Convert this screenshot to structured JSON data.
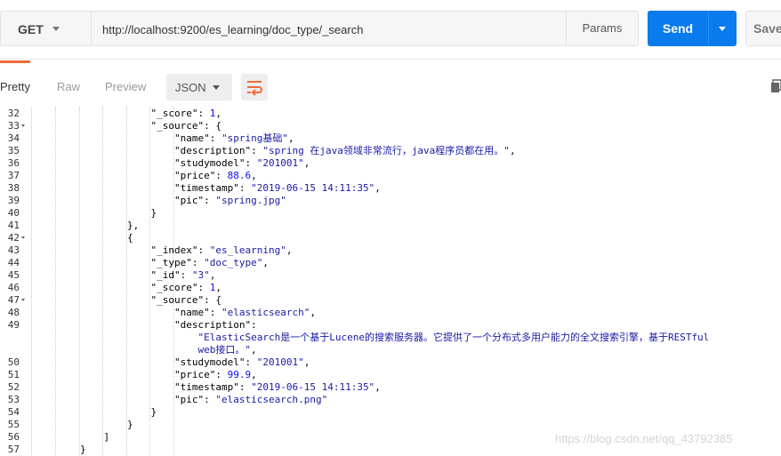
{
  "request": {
    "method": "GET",
    "url": "http://localhost:9200/es_learning/doc_type/_search",
    "params_label": "Params",
    "send_label": "Send",
    "save_label": "Save"
  },
  "response_toolbar": {
    "views": [
      "Pretty",
      "Raw",
      "Preview"
    ],
    "active_view": "Pretty",
    "format": "JSON"
  },
  "code_lines": [
    {
      "num": "32",
      "fold": false,
      "indent": 5,
      "parts": [
        [
          "k",
          "\"_score\""
        ],
        [
          "p",
          ": "
        ],
        [
          "n",
          "1"
        ],
        [
          "p",
          ","
        ]
      ]
    },
    {
      "num": "33",
      "fold": true,
      "indent": 5,
      "parts": [
        [
          "k",
          "\"_source\""
        ],
        [
          "p",
          ": {"
        ]
      ]
    },
    {
      "num": "34",
      "fold": false,
      "indent": 6,
      "parts": [
        [
          "k",
          "\"name\""
        ],
        [
          "p",
          ": "
        ],
        [
          "s",
          "\"spring基础\""
        ],
        [
          "p",
          ","
        ]
      ]
    },
    {
      "num": "35",
      "fold": false,
      "indent": 6,
      "parts": [
        [
          "k",
          "\"description\""
        ],
        [
          "p",
          ": "
        ],
        [
          "s",
          "\"spring 在java领域非常流行，java程序员都在用。\""
        ],
        [
          "p",
          ","
        ]
      ]
    },
    {
      "num": "36",
      "fold": false,
      "indent": 6,
      "parts": [
        [
          "k",
          "\"studymodel\""
        ],
        [
          "p",
          ": "
        ],
        [
          "s",
          "\"201001\""
        ],
        [
          "p",
          ","
        ]
      ]
    },
    {
      "num": "37",
      "fold": false,
      "indent": 6,
      "parts": [
        [
          "k",
          "\"price\""
        ],
        [
          "p",
          ": "
        ],
        [
          "n",
          "88.6"
        ],
        [
          "p",
          ","
        ]
      ]
    },
    {
      "num": "38",
      "fold": false,
      "indent": 6,
      "parts": [
        [
          "k",
          "\"timestamp\""
        ],
        [
          "p",
          ": "
        ],
        [
          "s",
          "\"2019-06-15 14:11:35\""
        ],
        [
          "p",
          ","
        ]
      ]
    },
    {
      "num": "39",
      "fold": false,
      "indent": 6,
      "parts": [
        [
          "k",
          "\"pic\""
        ],
        [
          "p",
          ": "
        ],
        [
          "s",
          "\"spring.jpg\""
        ]
      ]
    },
    {
      "num": "40",
      "fold": false,
      "indent": 5,
      "parts": [
        [
          "p",
          "}"
        ]
      ]
    },
    {
      "num": "41",
      "fold": false,
      "indent": 4,
      "parts": [
        [
          "p",
          "},"
        ]
      ]
    },
    {
      "num": "42",
      "fold": true,
      "indent": 4,
      "parts": [
        [
          "p",
          "{"
        ]
      ]
    },
    {
      "num": "43",
      "fold": false,
      "indent": 5,
      "parts": [
        [
          "k",
          "\"_index\""
        ],
        [
          "p",
          ": "
        ],
        [
          "s",
          "\"es_learning\""
        ],
        [
          "p",
          ","
        ]
      ]
    },
    {
      "num": "44",
      "fold": false,
      "indent": 5,
      "parts": [
        [
          "k",
          "\"_type\""
        ],
        [
          "p",
          ": "
        ],
        [
          "s",
          "\"doc_type\""
        ],
        [
          "p",
          ","
        ]
      ]
    },
    {
      "num": "45",
      "fold": false,
      "indent": 5,
      "parts": [
        [
          "k",
          "\"_id\""
        ],
        [
          "p",
          ": "
        ],
        [
          "s",
          "\"3\""
        ],
        [
          "p",
          ","
        ]
      ]
    },
    {
      "num": "46",
      "fold": false,
      "indent": 5,
      "parts": [
        [
          "k",
          "\"_score\""
        ],
        [
          "p",
          ": "
        ],
        [
          "n",
          "1"
        ],
        [
          "p",
          ","
        ]
      ]
    },
    {
      "num": "47",
      "fold": true,
      "indent": 5,
      "parts": [
        [
          "k",
          "\"_source\""
        ],
        [
          "p",
          ": {"
        ]
      ]
    },
    {
      "num": "48",
      "fold": false,
      "indent": 6,
      "parts": [
        [
          "k",
          "\"name\""
        ],
        [
          "p",
          ": "
        ],
        [
          "s",
          "\"elasticsearch\""
        ],
        [
          "p",
          ","
        ]
      ]
    },
    {
      "num": "49",
      "fold": false,
      "indent": 6,
      "parts": [
        [
          "k",
          "\"description\""
        ],
        [
          "p",
          ":"
        ]
      ]
    },
    {
      "num": "",
      "fold": false,
      "indent": 7,
      "parts": [
        [
          "s",
          "\"ElasticSearch是一个基于Lucene的搜索服务器。它提供了一个分布式多用户能力的全文搜索引擎，基于RESTful"
        ]
      ]
    },
    {
      "num": "",
      "fold": false,
      "indent": 7,
      "parts": [
        [
          "s",
          "web接口。\""
        ],
        [
          "p",
          ","
        ]
      ]
    },
    {
      "num": "50",
      "fold": false,
      "indent": 6,
      "parts": [
        [
          "k",
          "\"studymodel\""
        ],
        [
          "p",
          ": "
        ],
        [
          "s",
          "\"201001\""
        ],
        [
          "p",
          ","
        ]
      ]
    },
    {
      "num": "51",
      "fold": false,
      "indent": 6,
      "parts": [
        [
          "k",
          "\"price\""
        ],
        [
          "p",
          ": "
        ],
        [
          "n",
          "99.9"
        ],
        [
          "p",
          ","
        ]
      ]
    },
    {
      "num": "52",
      "fold": false,
      "indent": 6,
      "parts": [
        [
          "k",
          "\"timestamp\""
        ],
        [
          "p",
          ": "
        ],
        [
          "s",
          "\"2019-06-15 14:11:35\""
        ],
        [
          "p",
          ","
        ]
      ]
    },
    {
      "num": "53",
      "fold": false,
      "indent": 6,
      "parts": [
        [
          "k",
          "\"pic\""
        ],
        [
          "p",
          ": "
        ],
        [
          "s",
          "\"elasticsearch.png\""
        ]
      ]
    },
    {
      "num": "54",
      "fold": false,
      "indent": 5,
      "parts": [
        [
          "p",
          "}"
        ]
      ]
    },
    {
      "num": "55",
      "fold": false,
      "indent": 4,
      "parts": [
        [
          "p",
          "}"
        ]
      ]
    },
    {
      "num": "56",
      "fold": false,
      "indent": 3,
      "parts": [
        [
          "p",
          "]"
        ]
      ]
    },
    {
      "num": "57",
      "fold": false,
      "indent": 2,
      "parts": [
        [
          "p",
          "}"
        ]
      ]
    }
  ],
  "watermark": "https://blog.csdn.net/qq_43792385",
  "colors": {
    "send_button": "#097bed",
    "tab_accent": "#f26b3a",
    "json_string": "#1a1aa6",
    "json_number": "#0c0cff"
  }
}
